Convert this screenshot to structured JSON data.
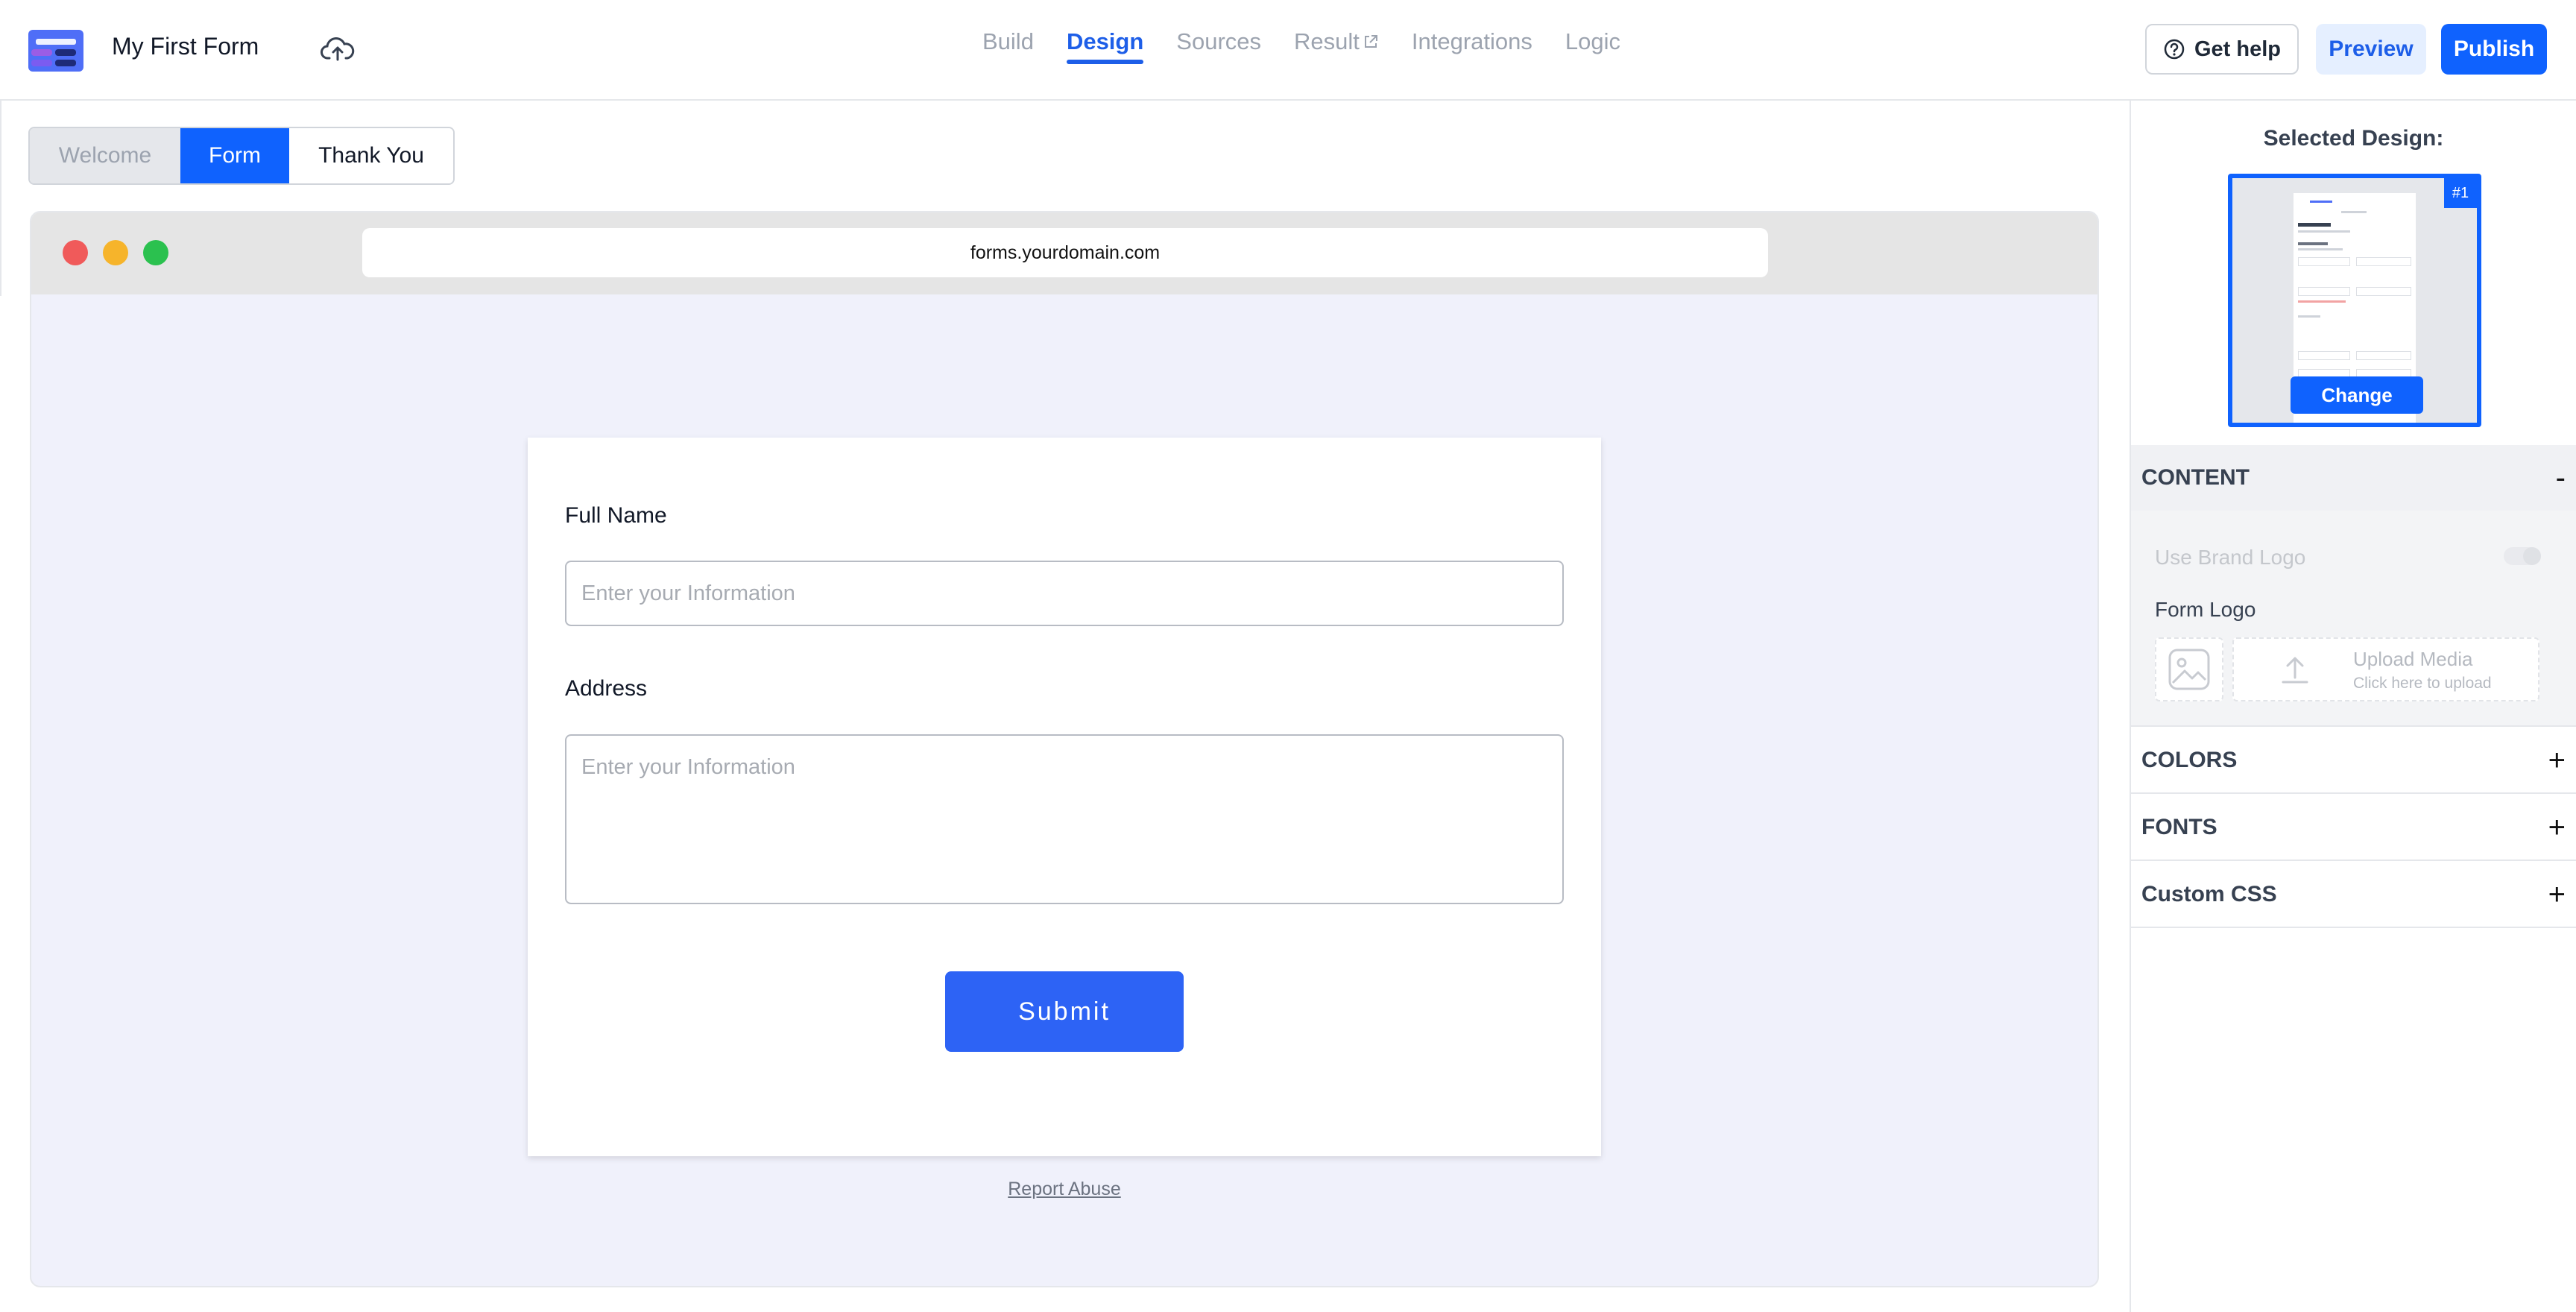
{
  "header": {
    "form_title": "My First Form",
    "nav": [
      {
        "label": "Build",
        "active": false
      },
      {
        "label": "Design",
        "active": true
      },
      {
        "label": "Sources",
        "active": false
      },
      {
        "label": "Result",
        "active": false,
        "external": true
      },
      {
        "label": "Integrations",
        "active": false
      },
      {
        "label": "Logic",
        "active": false
      }
    ],
    "help_label": "Get help",
    "preview_label": "Preview",
    "publish_label": "Publish"
  },
  "page_tabs": [
    {
      "label": "Welcome",
      "state": "disabled"
    },
    {
      "label": "Form",
      "state": "selected"
    },
    {
      "label": "Thank You",
      "state": "default"
    }
  ],
  "browser": {
    "url": "forms.yourdomain.com"
  },
  "form": {
    "fields": [
      {
        "label": "Full Name",
        "placeholder": "Enter your Information",
        "type": "text"
      },
      {
        "label": "Address",
        "placeholder": "Enter your Information",
        "type": "textarea"
      }
    ],
    "submit_label": "Submit",
    "report_link": "Report Abuse"
  },
  "panel": {
    "selected_title": "Selected Design:",
    "design_badge": "#1",
    "change_label": "Change",
    "content": {
      "title": "CONTENT",
      "toggle": "-",
      "use_brand_logo_label": "Use Brand Logo",
      "use_brand_logo_enabled": false,
      "form_logo_label": "Form Logo",
      "upload_title": "Upload Media",
      "upload_subtitle": "Click here to upload"
    },
    "sections": [
      {
        "title": "COLORS",
        "toggle": "+"
      },
      {
        "title": "FONTS",
        "toggle": "+"
      },
      {
        "title": "Custom CSS",
        "toggle": "+"
      }
    ]
  },
  "colors": {
    "accent": "#0f62fe",
    "submit": "#2d63f5",
    "canvas": "#f0f1fb"
  }
}
